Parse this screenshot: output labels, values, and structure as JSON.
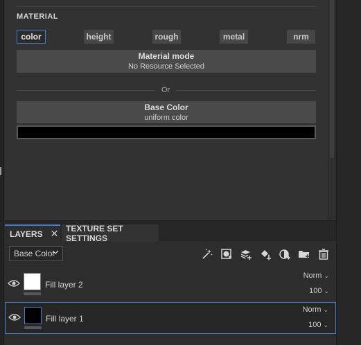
{
  "properties": {
    "section_title": "MATERIAL",
    "channels": [
      {
        "label": "color",
        "active": true
      },
      {
        "label": "height",
        "active": false
      },
      {
        "label": "rough",
        "active": false
      },
      {
        "label": "metal",
        "active": false
      },
      {
        "label": "nrm",
        "active": false
      }
    ],
    "material_mode": {
      "title": "Material mode",
      "value": "No Resource Selected"
    },
    "or_label": "Or",
    "base_color": {
      "title": "Base Color",
      "value": "uniform color",
      "swatch": "#000000"
    }
  },
  "layers_panel": {
    "tabs": [
      {
        "label": "LAYERS",
        "active": true
      },
      {
        "label": "TEXTURE SET SETTINGS",
        "active": false
      }
    ],
    "close_glyph": "✕",
    "channel_dropdown": "Base Color",
    "toolbar_icons": [
      "magic-wand-icon",
      "add-mask-icon",
      "add-layer-icon",
      "add-fill-icon",
      "add-effect-icon",
      "add-folder-icon",
      "delete-icon"
    ],
    "layers": [
      {
        "name": "Fill layer 2",
        "blend": "Norm",
        "opacity": "100",
        "thumb": "#ffffff",
        "selected": false
      },
      {
        "name": "Fill layer 1",
        "blend": "Norm",
        "opacity": "100",
        "thumb": "#000000",
        "selected": true
      }
    ]
  },
  "colors": {
    "accent": "#3d7fd6"
  }
}
